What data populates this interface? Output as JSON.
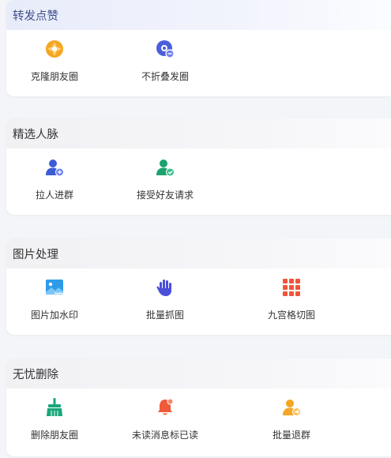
{
  "sections": [
    {
      "title": "转发点赞",
      "items": [
        {
          "label": "克隆朋友圈",
          "icon": "aperture-icon",
          "color": "#f5a623"
        },
        {
          "label": "不折叠发圈",
          "icon": "unfold-settings-icon",
          "color": "#4a5fd8"
        }
      ]
    },
    {
      "title": "精选人脉",
      "items": [
        {
          "label": "拉人进群",
          "icon": "add-user-icon",
          "color": "#3c5bd6"
        },
        {
          "label": "接受好友请求",
          "icon": "accept-friend-icon",
          "color": "#1aa36f"
        }
      ]
    },
    {
      "title": "图片处理",
      "items": [
        {
          "label": "图片加水印",
          "icon": "image-watermark-icon",
          "color": "#2d9be8"
        },
        {
          "label": "批量抓图",
          "icon": "hand-grab-icon",
          "color": "#4a4fd8"
        },
        {
          "label": "九宫格切图",
          "icon": "nine-grid-icon",
          "color": "#f0553a"
        }
      ]
    },
    {
      "title": "无忧删除",
      "items": [
        {
          "label": "删除朋友圈",
          "icon": "broom-icon",
          "color": "#19a67a"
        },
        {
          "label": "未读消息标已读",
          "icon": "bell-icon",
          "color": "#f05a3a"
        },
        {
          "label": "批量退群",
          "icon": "leave-group-icon",
          "color": "#f5a623"
        }
      ]
    }
  ]
}
